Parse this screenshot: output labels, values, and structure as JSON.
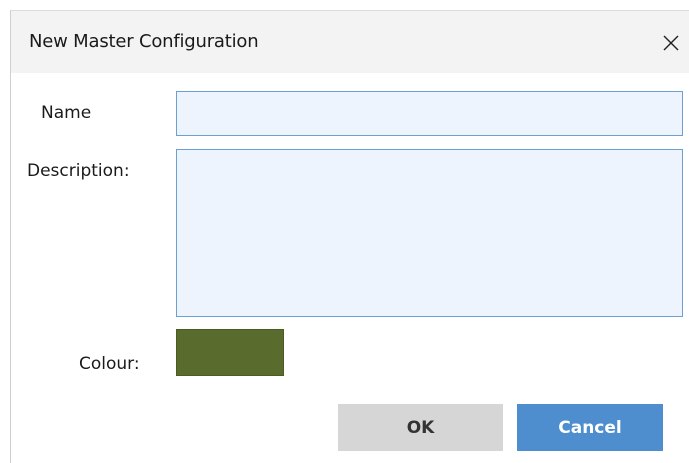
{
  "dialog": {
    "title": "New Master Configuration",
    "close_icon": "close-icon"
  },
  "form": {
    "name_label": "Name",
    "name_value": "",
    "description_label": "Description:",
    "description_value": "",
    "colour_label": "Colour:",
    "colour_value": "#5a6b2e"
  },
  "buttons": {
    "ok_label": "OK",
    "cancel_label": "Cancel"
  },
  "colors": {
    "field_background": "#eef4fd",
    "field_border": "#6da0cf",
    "titlebar_background": "#f3f3f3",
    "ok_background": "#d6d6d6",
    "cancel_background": "#4e8ece"
  }
}
